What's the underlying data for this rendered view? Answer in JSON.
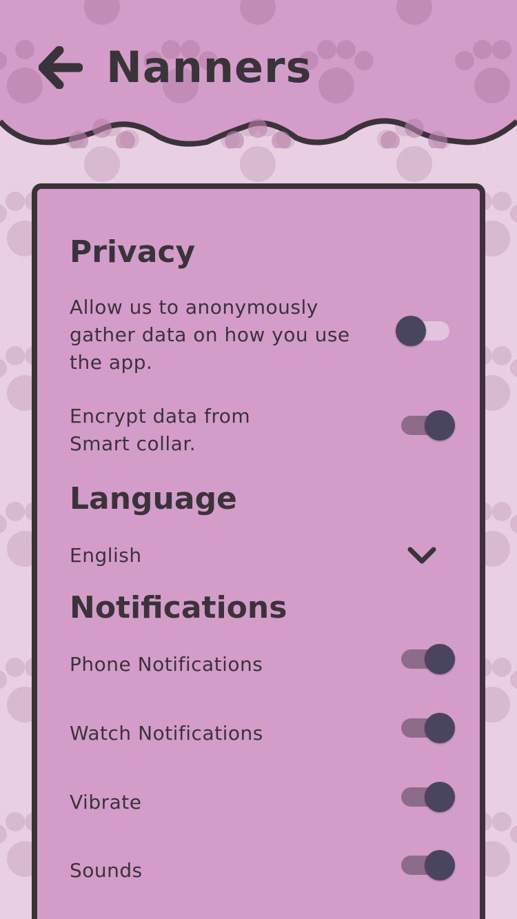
{
  "header": {
    "title": "Nanners",
    "back_icon": "arrow-left-icon"
  },
  "privacy": {
    "title": "Privacy",
    "items": [
      {
        "label": "Allow us to anonymously gather data on how you use the app.",
        "enabled": false
      },
      {
        "label": "Encrypt data from Smart collar.",
        "enabled": true
      }
    ]
  },
  "language": {
    "title": "Language",
    "selected": "English",
    "icon": "chevron-down-icon"
  },
  "notifications": {
    "title": "Notifications",
    "items": [
      {
        "label": "Phone Notifications",
        "enabled": true
      },
      {
        "label": "Watch Notifications",
        "enabled": true
      },
      {
        "label": "Vibrate",
        "enabled": true
      },
      {
        "label": "Sounds",
        "enabled": true
      }
    ]
  },
  "colors": {
    "background": "#e8cfe2",
    "header": "#d49cc8",
    "card": "#d49cc8",
    "text": "#393438",
    "knob": "#4a455e",
    "track_on": "#8c6c87",
    "track_off": "#e4c3dc"
  }
}
